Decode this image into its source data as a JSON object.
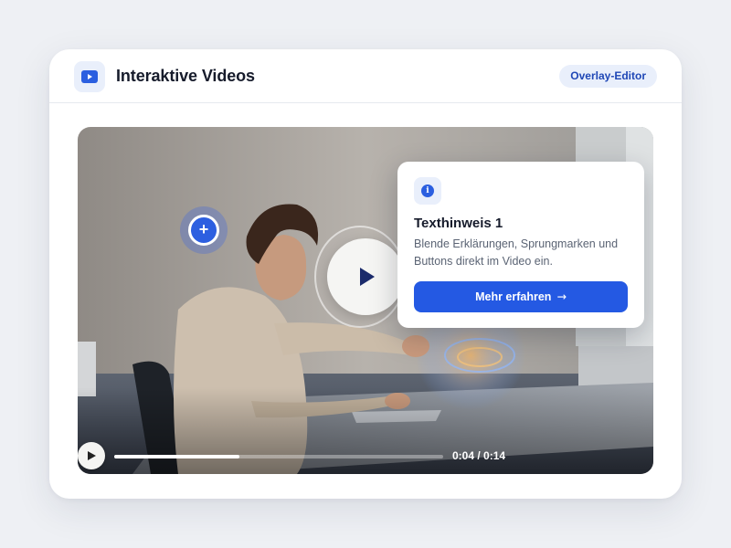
{
  "header": {
    "title": "Interaktive Videos",
    "badge": "Overlay-Editor",
    "icon": "video-play-icon"
  },
  "video": {
    "hotspot_symbol": "+",
    "progress_fraction": 0.38,
    "time_display": "0:04 / 0:14"
  },
  "popover": {
    "info_symbol": "i",
    "title": "Texthinweis 1",
    "text": "Blende Erklärungen, Sprungmarken und Buttons direkt im Video ein.",
    "cta_label": "Mehr erfahren",
    "cta_arrow": "→"
  },
  "colors": {
    "accent": "#2459e3",
    "badge_bg": "#e9effb",
    "badge_text": "#1f47b6"
  }
}
